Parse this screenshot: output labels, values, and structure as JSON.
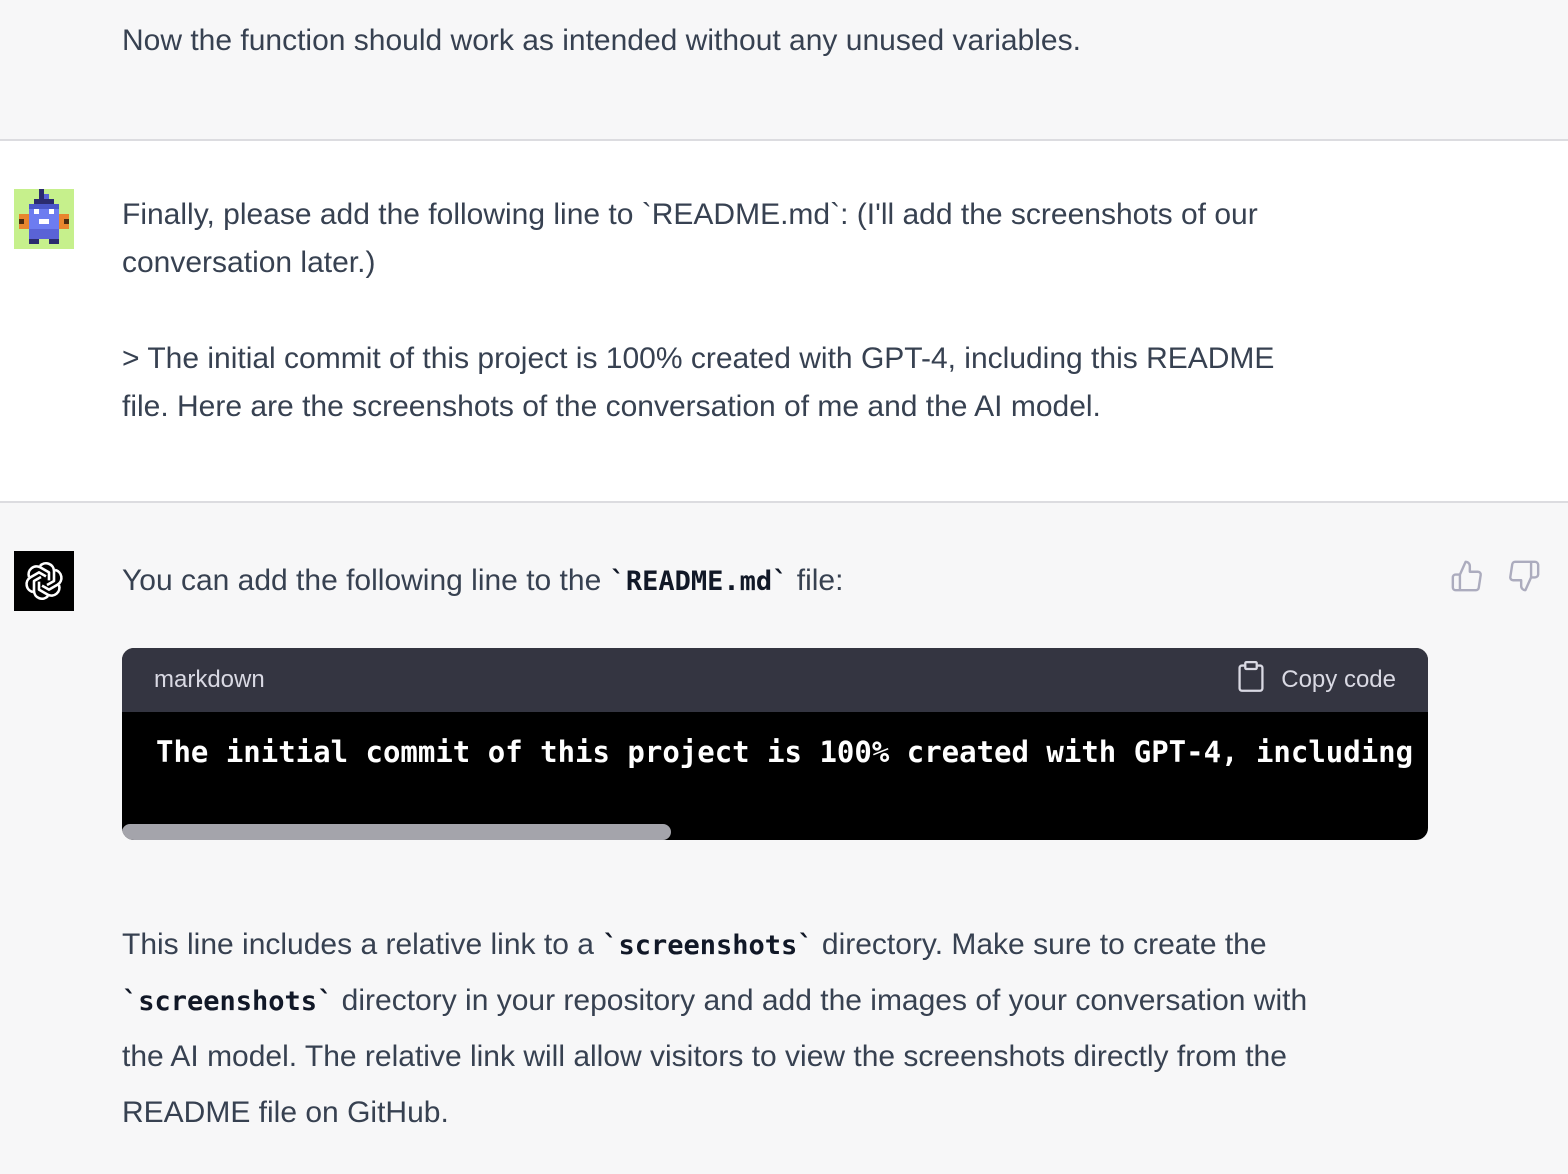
{
  "previous_reply": {
    "text": "Now the function should work as intended without any unused variables."
  },
  "user_message": {
    "line1": "Finally, please add the following line to `README.md`: (I'll add the screenshots of our",
    "line2": "conversation later.)",
    "quote_line1": "> The initial commit of this project is 100% created with GPT-4, including this README",
    "quote_line2": "file. Here are the screenshots of the conversation of me and the AI model."
  },
  "assistant_message": {
    "intro_before": "You can add the following line to the ",
    "intro_code": "`README.md`",
    "intro_after": " file:",
    "code_block": {
      "language": "markdown",
      "copy_label": "Copy code",
      "code": "The initial commit of this project is 100% created with GPT-4, including this README file. Here are the [screenshots](./screenshots) of the conversation of me and the AI model.",
      "scroll_position": 0.0,
      "visible_fraction": 0.42
    },
    "para_l1_before": "This line includes a relative link to a ",
    "para_l1_code": "`screenshots`",
    "para_l1_after": " directory. Make sure to create the",
    "para_l2_code": "`screenshots`",
    "para_l2_after": " directory in your repository and add the images of your conversation with",
    "para_l3": "the AI model. The relative link will allow visitors to view the screenshots directly from the",
    "para_l4": "README file on GitHub."
  },
  "icons": {
    "user_avatar": "pixel-art-avatar-icon",
    "assistant_avatar": "openai-logo-icon",
    "copy": "clipboard-icon",
    "like": "thumbs-up-icon",
    "dislike": "thumbs-down-icon"
  },
  "colors": {
    "background": "#f7f7f8",
    "user_background": "#ffffff",
    "code_header": "#343541",
    "code_body": "#000000",
    "user_avatar_bg": "#c6f08c"
  }
}
